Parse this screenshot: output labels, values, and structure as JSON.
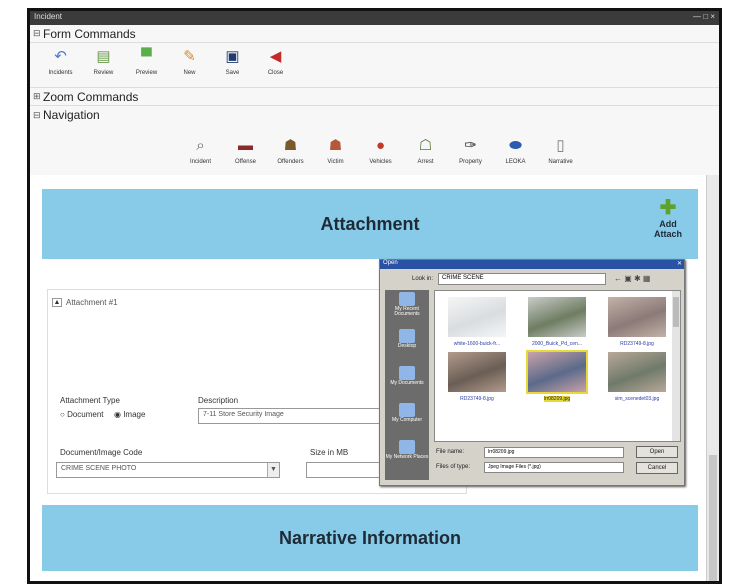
{
  "window": {
    "title": "Incident",
    "controls": "— □ ×"
  },
  "form_commands": {
    "header": "Form Commands",
    "buttons": [
      {
        "label": "Incidents",
        "icon": "undo-arrow-icon",
        "glyph": "↶",
        "color": "#4e7ac7"
      },
      {
        "label": "Review",
        "icon": "review-document-icon",
        "glyph": "▤",
        "color": "#6a9a4a"
      },
      {
        "label": "Preview",
        "icon": "printer-icon",
        "glyph": "▀",
        "color": "#5cae4a"
      },
      {
        "label": "New",
        "icon": "new-document-icon",
        "glyph": "✎",
        "color": "#d98a2a"
      },
      {
        "label": "Save",
        "icon": "save-disk-icon",
        "glyph": "▣",
        "color": "#1e3c6e"
      },
      {
        "label": "Close",
        "icon": "close-door-icon",
        "glyph": "◀",
        "color": "#c52a2a"
      }
    ]
  },
  "zoom_commands": {
    "header": "Zoom Commands"
  },
  "navigation": {
    "header": "Navigation",
    "items": [
      {
        "label": "Incident",
        "icon": "magnifier-icon",
        "glyph": "⌕",
        "color": "#666"
      },
      {
        "label": "Offense",
        "icon": "gun-icon",
        "glyph": "▬",
        "color": "#8a2b2b"
      },
      {
        "label": "Offenders",
        "icon": "offenders-icon",
        "glyph": "☗",
        "color": "#7a5a2a"
      },
      {
        "label": "Victim",
        "icon": "victim-icon",
        "glyph": "☗",
        "color": "#b5583a"
      },
      {
        "label": "Vehicles",
        "icon": "vehicle-icon",
        "glyph": "●",
        "color": "#c0392b"
      },
      {
        "label": "Arrest",
        "icon": "arrest-icon",
        "glyph": "☖",
        "color": "#5a7a3a"
      },
      {
        "label": "Property",
        "icon": "property-tag-icon",
        "glyph": "✑",
        "color": "#333"
      },
      {
        "label": "LEOKA",
        "icon": "leoka-icon",
        "glyph": "⬬",
        "color": "#2a5db0"
      },
      {
        "label": "Narrative",
        "icon": "narrative-document-icon",
        "glyph": "▯",
        "color": "#777"
      }
    ]
  },
  "attachment": {
    "banner_title": "Attachment",
    "add_attach_label": "Add\nAttach",
    "item_title": "Attachment #1",
    "type_label": "Attachment Type",
    "type_options": [
      "Document",
      "Image"
    ],
    "type_selected": "Image",
    "description_label": "Description",
    "description_value": "7-11 Store Security Image",
    "code_label": "Document/Image Code",
    "code_value": "CRIME SCENE PHOTO",
    "size_label": "Size in MB",
    "size_value": ""
  },
  "narrative": {
    "banner_title": "Narrative Information"
  },
  "open_dialog": {
    "title": "Open",
    "look_in_label": "Look in:",
    "look_in_value": "CRIME SCENE",
    "places": [
      {
        "label": "My Recent Documents",
        "icon": "recent-documents-icon"
      },
      {
        "label": "Desktop",
        "icon": "desktop-icon"
      },
      {
        "label": "My Documents",
        "icon": "my-documents-icon"
      },
      {
        "label": "My Computer",
        "icon": "my-computer-icon"
      },
      {
        "label": "My Network Places",
        "icon": "network-places-icon"
      }
    ],
    "files": [
      {
        "name": "white-1600-buick-fr...",
        "selected": false,
        "bg": "#d9dde0",
        "fg": "#f5f5f5"
      },
      {
        "name": "2000_Buick_Pd_cen...",
        "selected": false,
        "bg": "#6f7d62",
        "fg": "#c9ccc8"
      },
      {
        "name": "RD23749-8.jpg",
        "selected": false,
        "bg": "#8b7a77",
        "fg": "#c2b2a8"
      },
      {
        "name": "RD23749-8.jpg",
        "selected": false,
        "bg": "#6a5e55",
        "fg": "#b49a8c"
      },
      {
        "name": "lrr08209.jpg",
        "selected": true,
        "bg": "#5b6a8a",
        "fg": "#c9a2a8"
      },
      {
        "name": "sim_scenedet03.jpg",
        "selected": false,
        "bg": "#707a6a",
        "fg": "#b8a899"
      }
    ],
    "file_name_label": "File name:",
    "file_name_value": "lrr08209.jpg",
    "file_type_label": "Files of type:",
    "file_type_value": "Jpeg Image Files (*.jpg)",
    "open_button": "Open",
    "cancel_button": "Cancel"
  }
}
